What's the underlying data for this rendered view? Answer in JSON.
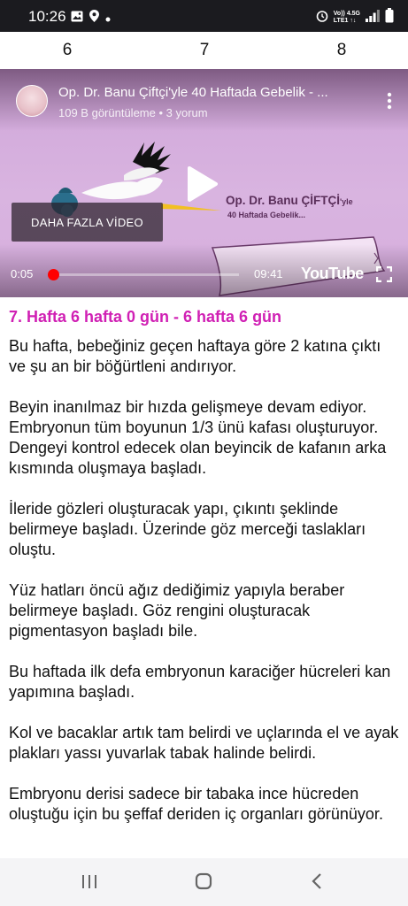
{
  "status_bar": {
    "time": "10:26",
    "network_top": "Vo)) 4.5G",
    "network_bottom": "LTE1 ↑↓"
  },
  "week_tabs": [
    "6",
    "7",
    "8"
  ],
  "video": {
    "title": "Op. Dr. Banu Çiftçi'yle 40 Haftada Gebelik - ...",
    "meta": "109 B görüntüleme • 3 yorum",
    "ribbon_title": "Op. Dr. Banu ÇİFTÇİ",
    "ribbon_title_suffix": "'yle",
    "ribbon_subtitle": "40 Haftada Gebelik...",
    "more_videos_label": "DAHA FAZLA VİDEO",
    "current_time": "0:05",
    "total_time": "09:41",
    "progress_fraction": 0.009,
    "logo_text": "YouTube"
  },
  "article": {
    "heading": "7. Hafta 6 hafta 0 gün - 6 hafta 6 gün",
    "paragraphs": [
      "Bu hafta, bebeğiniz geçen haftaya göre 2 katına çıktı ve şu an bir böğürtleni andırıyor.",
      "Beyin inanılmaz bir hızda gelişmeye devam ediyor. Embryonun tüm boyunun 1/3 ünü kafası oluşturuyor. Dengeyi kontrol edecek olan beyincik de kafanın arka kısmında oluşmaya başladı.",
      "İleride gözleri oluşturacak yapı, çıkıntı şeklinde belirmeye başladı. Üzerinde göz merceği taslakları oluştu.",
      "Yüz hatları öncü ağız dediğimiz yapıyla beraber belirmeye başladı. Göz rengini oluşturacak pigmentasyon başladı bile.",
      "Bu haftada ilk defa embryonun karaciğer hücreleri kan yapımına başladı.",
      "Kol ve bacaklar artık tam belirdi ve uçlarında el ve ayak plakları yassı yuvarlak tabak halinde belirdi.",
      "Embryonu derisi sadece bir tabaka ince hücreden oluştuğu için bu şeffaf deriden iç organları görünüyor."
    ]
  },
  "colors": {
    "heading": "#d020b4",
    "progress": "#ff0000",
    "video_background": "#d6aedd",
    "ribbon_text": "#5a2e5a"
  },
  "icons": [
    "image-icon",
    "location-icon",
    "dot-icon",
    "alarm-icon",
    "signal-icon",
    "battery-icon",
    "more-vert-icon",
    "play-icon",
    "fullscreen-icon",
    "recents-icon",
    "home-icon",
    "back-icon"
  ]
}
